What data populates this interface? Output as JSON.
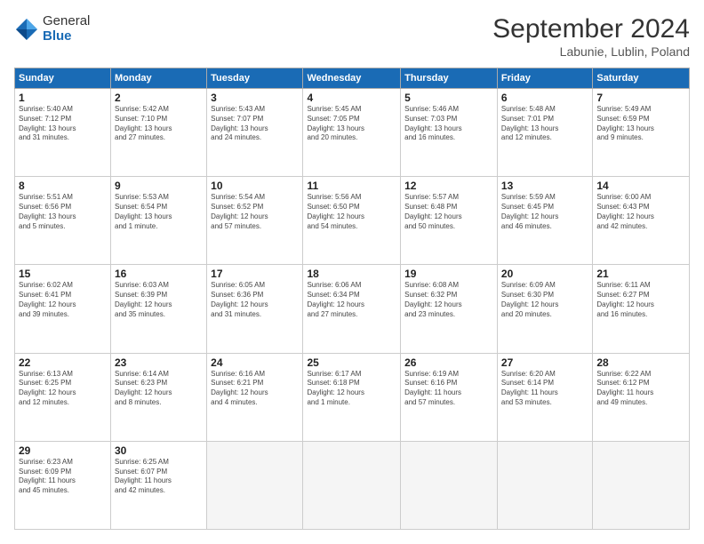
{
  "header": {
    "logo_general": "General",
    "logo_blue": "Blue",
    "month_title": "September 2024",
    "location": "Labunie, Lublin, Poland"
  },
  "weekdays": [
    "Sunday",
    "Monday",
    "Tuesday",
    "Wednesday",
    "Thursday",
    "Friday",
    "Saturday"
  ],
  "days": [
    {
      "num": "1",
      "info": "Sunrise: 5:40 AM\nSunset: 7:12 PM\nDaylight: 13 hours\nand 31 minutes."
    },
    {
      "num": "2",
      "info": "Sunrise: 5:42 AM\nSunset: 7:10 PM\nDaylight: 13 hours\nand 27 minutes."
    },
    {
      "num": "3",
      "info": "Sunrise: 5:43 AM\nSunset: 7:07 PM\nDaylight: 13 hours\nand 24 minutes."
    },
    {
      "num": "4",
      "info": "Sunrise: 5:45 AM\nSunset: 7:05 PM\nDaylight: 13 hours\nand 20 minutes."
    },
    {
      "num": "5",
      "info": "Sunrise: 5:46 AM\nSunset: 7:03 PM\nDaylight: 13 hours\nand 16 minutes."
    },
    {
      "num": "6",
      "info": "Sunrise: 5:48 AM\nSunset: 7:01 PM\nDaylight: 13 hours\nand 12 minutes."
    },
    {
      "num": "7",
      "info": "Sunrise: 5:49 AM\nSunset: 6:59 PM\nDaylight: 13 hours\nand 9 minutes."
    },
    {
      "num": "8",
      "info": "Sunrise: 5:51 AM\nSunset: 6:56 PM\nDaylight: 13 hours\nand 5 minutes."
    },
    {
      "num": "9",
      "info": "Sunrise: 5:53 AM\nSunset: 6:54 PM\nDaylight: 13 hours\nand 1 minute."
    },
    {
      "num": "10",
      "info": "Sunrise: 5:54 AM\nSunset: 6:52 PM\nDaylight: 12 hours\nand 57 minutes."
    },
    {
      "num": "11",
      "info": "Sunrise: 5:56 AM\nSunset: 6:50 PM\nDaylight: 12 hours\nand 54 minutes."
    },
    {
      "num": "12",
      "info": "Sunrise: 5:57 AM\nSunset: 6:48 PM\nDaylight: 12 hours\nand 50 minutes."
    },
    {
      "num": "13",
      "info": "Sunrise: 5:59 AM\nSunset: 6:45 PM\nDaylight: 12 hours\nand 46 minutes."
    },
    {
      "num": "14",
      "info": "Sunrise: 6:00 AM\nSunset: 6:43 PM\nDaylight: 12 hours\nand 42 minutes."
    },
    {
      "num": "15",
      "info": "Sunrise: 6:02 AM\nSunset: 6:41 PM\nDaylight: 12 hours\nand 39 minutes."
    },
    {
      "num": "16",
      "info": "Sunrise: 6:03 AM\nSunset: 6:39 PM\nDaylight: 12 hours\nand 35 minutes."
    },
    {
      "num": "17",
      "info": "Sunrise: 6:05 AM\nSunset: 6:36 PM\nDaylight: 12 hours\nand 31 minutes."
    },
    {
      "num": "18",
      "info": "Sunrise: 6:06 AM\nSunset: 6:34 PM\nDaylight: 12 hours\nand 27 minutes."
    },
    {
      "num": "19",
      "info": "Sunrise: 6:08 AM\nSunset: 6:32 PM\nDaylight: 12 hours\nand 23 minutes."
    },
    {
      "num": "20",
      "info": "Sunrise: 6:09 AM\nSunset: 6:30 PM\nDaylight: 12 hours\nand 20 minutes."
    },
    {
      "num": "21",
      "info": "Sunrise: 6:11 AM\nSunset: 6:27 PM\nDaylight: 12 hours\nand 16 minutes."
    },
    {
      "num": "22",
      "info": "Sunrise: 6:13 AM\nSunset: 6:25 PM\nDaylight: 12 hours\nand 12 minutes."
    },
    {
      "num": "23",
      "info": "Sunrise: 6:14 AM\nSunset: 6:23 PM\nDaylight: 12 hours\nand 8 minutes."
    },
    {
      "num": "24",
      "info": "Sunrise: 6:16 AM\nSunset: 6:21 PM\nDaylight: 12 hours\nand 4 minutes."
    },
    {
      "num": "25",
      "info": "Sunrise: 6:17 AM\nSunset: 6:18 PM\nDaylight: 12 hours\nand 1 minute."
    },
    {
      "num": "26",
      "info": "Sunrise: 6:19 AM\nSunset: 6:16 PM\nDaylight: 11 hours\nand 57 minutes."
    },
    {
      "num": "27",
      "info": "Sunrise: 6:20 AM\nSunset: 6:14 PM\nDaylight: 11 hours\nand 53 minutes."
    },
    {
      "num": "28",
      "info": "Sunrise: 6:22 AM\nSunset: 6:12 PM\nDaylight: 11 hours\nand 49 minutes."
    },
    {
      "num": "29",
      "info": "Sunrise: 6:23 AM\nSunset: 6:09 PM\nDaylight: 11 hours\nand 45 minutes."
    },
    {
      "num": "30",
      "info": "Sunrise: 6:25 AM\nSunset: 6:07 PM\nDaylight: 11 hours\nand 42 minutes."
    }
  ]
}
